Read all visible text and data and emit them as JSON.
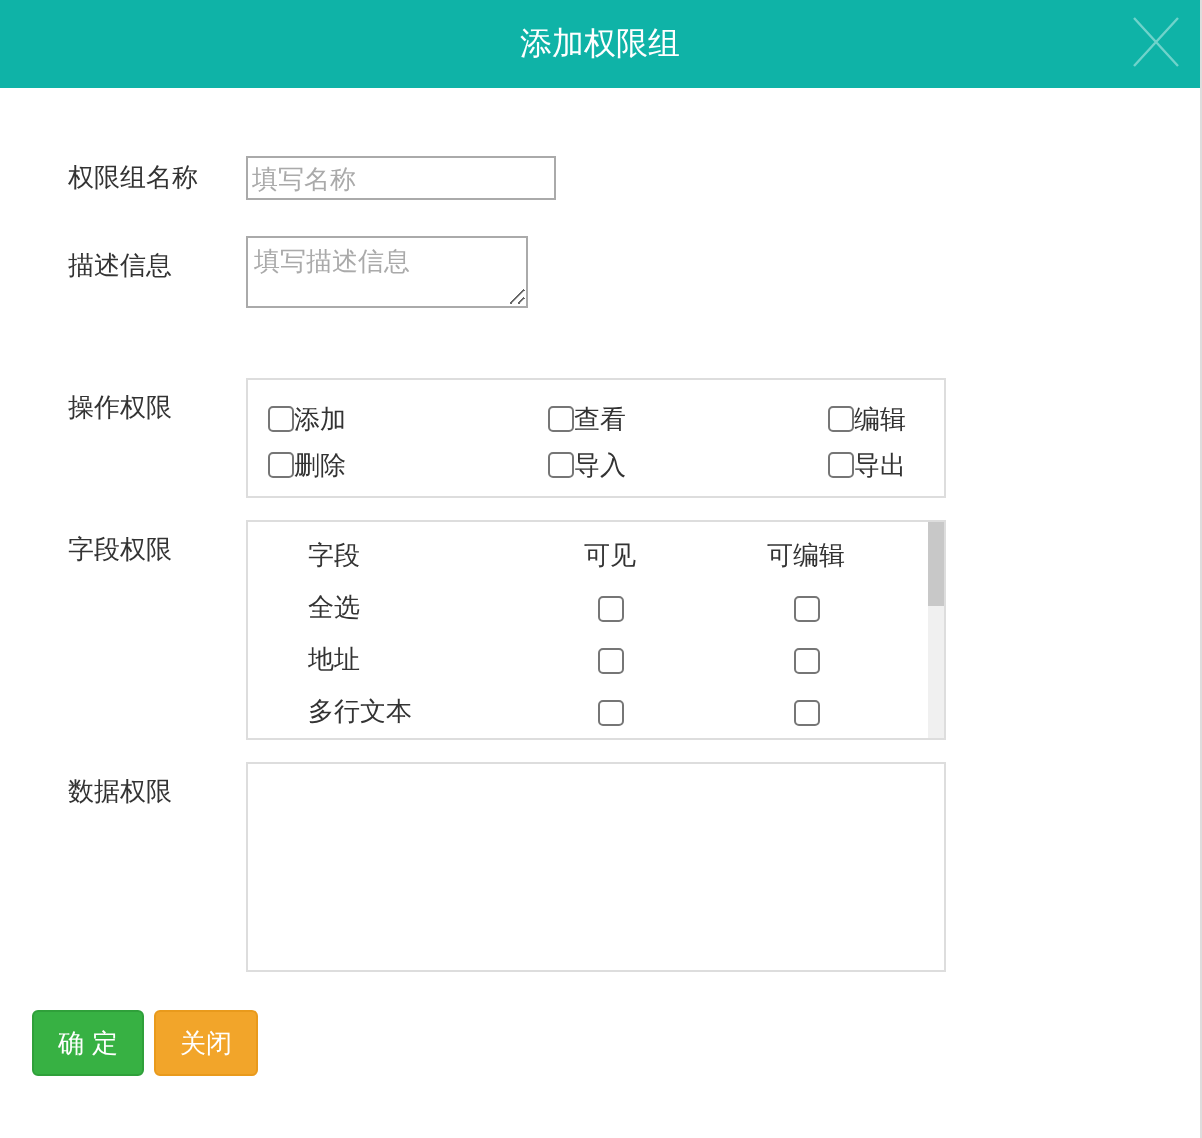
{
  "dialog": {
    "title": "添加权限组"
  },
  "form": [
    {
      "kind": "text",
      "label": "权限组名称",
      "placeholder": "填写名称"
    },
    {
      "kind": "textarea",
      "label": "描述信息",
      "placeholder": "填写描述信息"
    },
    {
      "kind": "checks",
      "label": "操作权限",
      "options": [
        {
          "label": "添加",
          "checked": false
        },
        {
          "label": "查看",
          "checked": false
        },
        {
          "label": "编辑",
          "checked": false
        },
        {
          "label": "删除",
          "checked": false
        },
        {
          "label": "导入",
          "checked": false
        },
        {
          "label": "导出",
          "checked": false
        }
      ]
    },
    {
      "kind": "fields",
      "label": "字段权限",
      "columns": [
        "字段",
        "可见",
        "可编辑"
      ],
      "rows": [
        {
          "name": "全选",
          "visible": false,
          "editable": false
        },
        {
          "name": "地址",
          "visible": false,
          "editable": false
        },
        {
          "name": "多行文本",
          "visible": false,
          "editable": false
        }
      ]
    },
    {
      "kind": "area",
      "label": "数据权限"
    }
  ],
  "buttons": [
    {
      "label": "确 定",
      "kind": "primary"
    },
    {
      "label": "关闭",
      "kind": "warning"
    }
  ]
}
